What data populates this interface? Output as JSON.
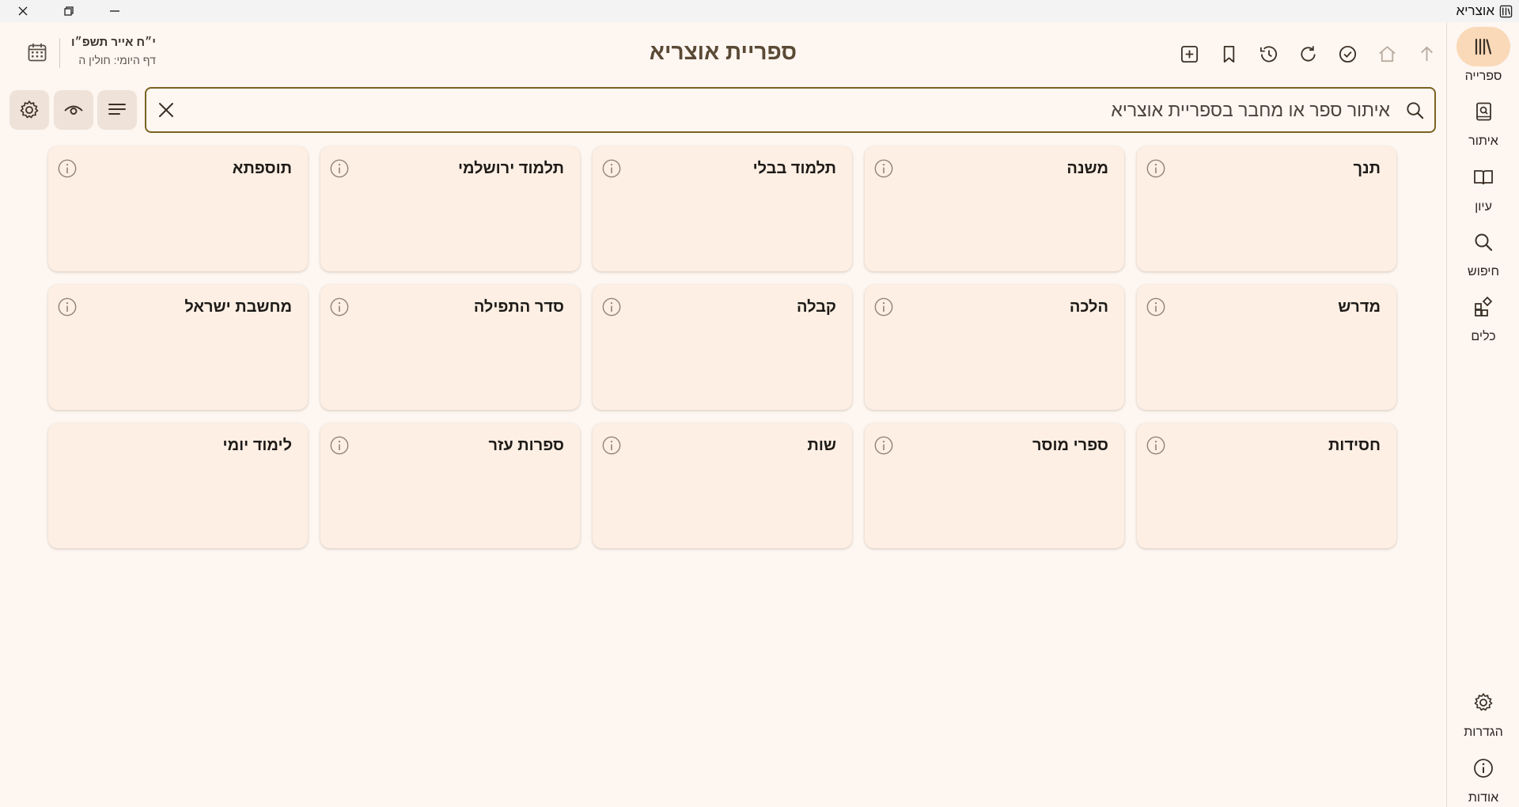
{
  "app": {
    "title": "אוצריא"
  },
  "rail": {
    "items": [
      {
        "label": "ספרייה",
        "icon": "library-icon"
      },
      {
        "label": "איתור",
        "icon": "find-book-icon"
      },
      {
        "label": "עיון",
        "icon": "open-book-icon"
      },
      {
        "label": "חיפוש",
        "icon": "search-icon"
      },
      {
        "label": "כלים",
        "icon": "tools-icon"
      },
      {
        "label": "הגדרות",
        "icon": "settings-icon"
      },
      {
        "label": "אודות",
        "icon": "info-icon"
      }
    ],
    "active_index": 0
  },
  "header": {
    "title": "ספריית אוצריא",
    "hebrew_date": "י״ח אייר תשפ״ו",
    "daf_yomi": "דף היומי: חולין ה"
  },
  "search": {
    "placeholder": "איתור ספר או מחבר בספריית אוצריא",
    "value": ""
  },
  "categories": [
    "תנך",
    "משנה",
    "תלמוד בבלי",
    "תלמוד ירושלמי",
    "תוספתא",
    "מדרש",
    "הלכה",
    "קבלה",
    "סדר התפילה",
    "מחשבת ישראל",
    "חסידות",
    "ספרי מוסר",
    "שות",
    "ספרות עזר",
    "לימוד יומי"
  ],
  "theme": {
    "accent": "#7b6223",
    "background": "#fdf6f1",
    "card": "#fdefe4",
    "active_pill": "#fad9b8"
  }
}
